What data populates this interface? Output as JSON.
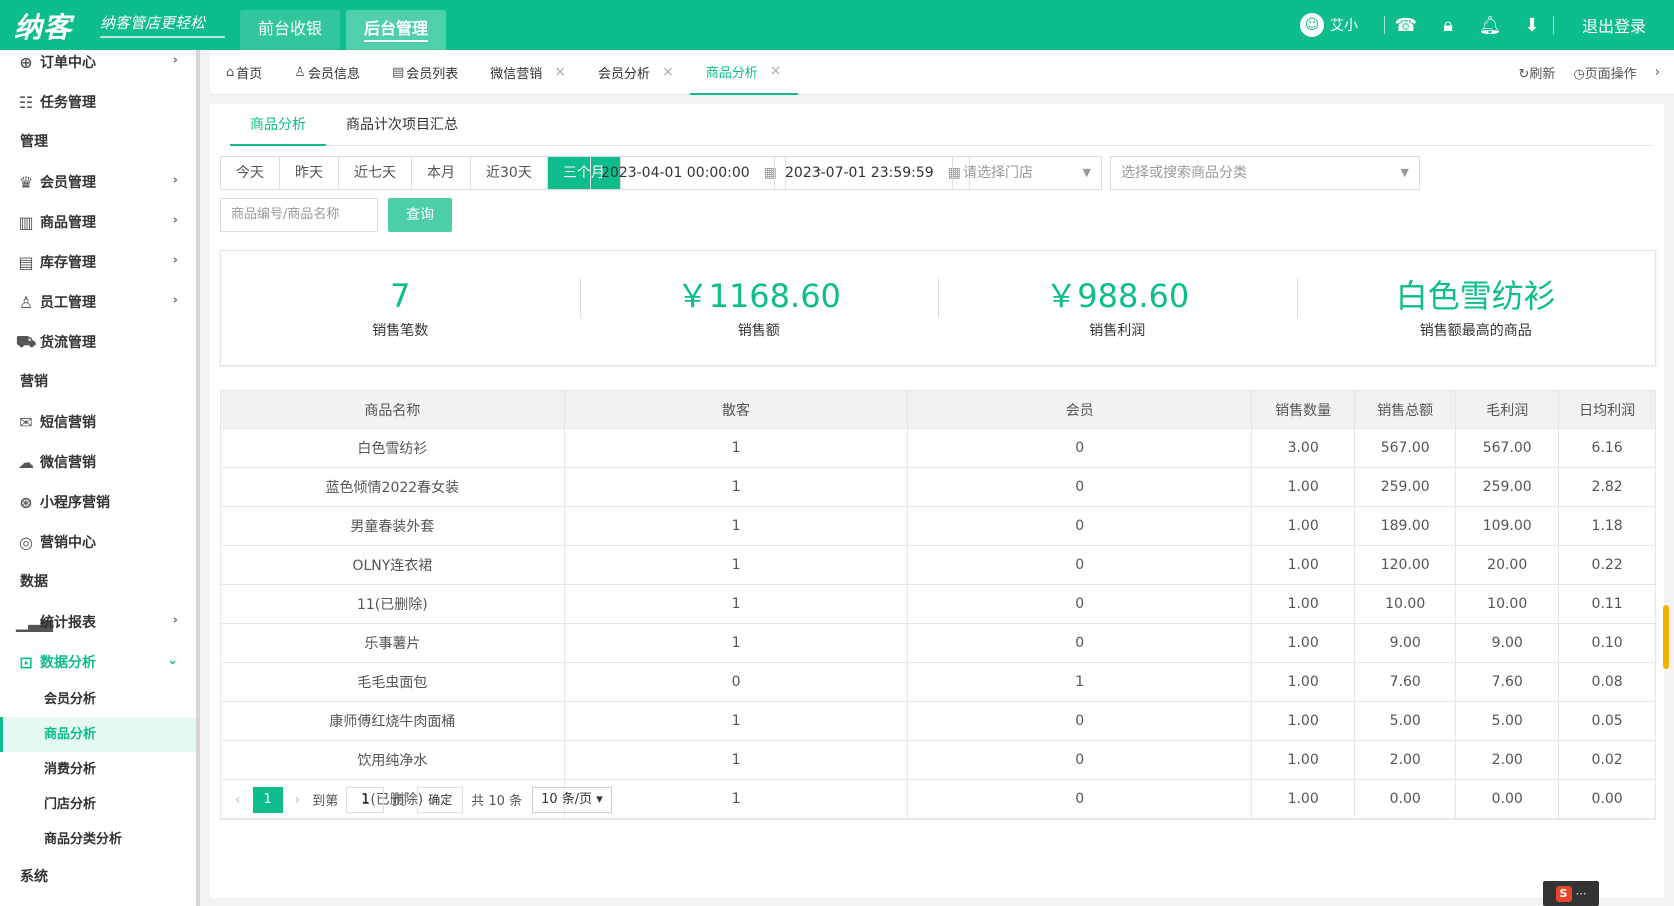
{
  "brand": {
    "logo": "纳客",
    "slogan": "纳客管店更轻松"
  },
  "topnav": [
    {
      "label": "前台收银"
    },
    {
      "label": "后台管理"
    }
  ],
  "user": {
    "name": "艾小",
    "logout": "退出登录"
  },
  "sidebar": {
    "items": [
      {
        "label": "订单中心"
      },
      {
        "label": "任务管理"
      },
      {
        "group": "管理"
      },
      {
        "label": "会员管理"
      },
      {
        "label": "商品管理"
      },
      {
        "label": "库存管理"
      },
      {
        "label": "员工管理"
      },
      {
        "label": "货流管理"
      },
      {
        "group": "营销"
      },
      {
        "label": "短信营销"
      },
      {
        "label": "微信营销"
      },
      {
        "label": "小程序营销"
      },
      {
        "label": "营销中心"
      },
      {
        "group": "数据"
      },
      {
        "label": "统计报表"
      },
      {
        "label": "数据分析"
      },
      {
        "sub": "会员分析"
      },
      {
        "sub": "商品分析"
      },
      {
        "sub": "消费分析"
      },
      {
        "sub": "门店分析"
      },
      {
        "sub": "商品分类分析"
      },
      {
        "group": "系统"
      }
    ]
  },
  "tabs": [
    {
      "label": "首页"
    },
    {
      "label": "会员信息"
    },
    {
      "label": "会员列表"
    },
    {
      "label": "微信营销"
    },
    {
      "label": "会员分析"
    },
    {
      "label": "商品分析"
    }
  ],
  "tab_actions": {
    "refresh": "刷新",
    "page_ops": "页面操作"
  },
  "subtabs": [
    {
      "label": "商品分析"
    },
    {
      "label": "商品计次项目汇总"
    }
  ],
  "filters": {
    "ranges": [
      "今天",
      "昨天",
      "近七天",
      "本月",
      "近30天",
      "三个月"
    ],
    "start": "2023-04-01 00:00:00",
    "end": "2023-07-01 23:59:59",
    "dash": "-",
    "store_placeholder": "请选择门店",
    "category_placeholder": "选择或搜索商品分类",
    "search_placeholder": "商品编号/商品名称",
    "query": "查询"
  },
  "stats": [
    {
      "value": "7",
      "label": "销售笔数"
    },
    {
      "value": "￥1168.60",
      "label": "销售额"
    },
    {
      "value": "￥988.60",
      "label": "销售利润"
    },
    {
      "value": "白色雪纺衫",
      "label": "销售额最高的商品"
    }
  ],
  "table": {
    "columns": [
      "商品名称",
      "散客",
      "会员",
      "销售数量",
      "销售总额",
      "毛利润",
      "日均利润"
    ],
    "rows": [
      [
        "白色雪纺衫",
        "1",
        "0",
        "3.00",
        "567.00",
        "567.00",
        "6.16"
      ],
      [
        "蓝色倾情2022春女装",
        "1",
        "0",
        "1.00",
        "259.00",
        "259.00",
        "2.82"
      ],
      [
        "男童春装外套",
        "1",
        "0",
        "1.00",
        "189.00",
        "109.00",
        "1.18"
      ],
      [
        "OLNY连衣裙",
        "1",
        "0",
        "1.00",
        "120.00",
        "20.00",
        "0.22"
      ],
      [
        "11(已删除)",
        "1",
        "0",
        "1.00",
        "10.00",
        "10.00",
        "0.11"
      ],
      [
        "乐事薯片",
        "1",
        "0",
        "1.00",
        "9.00",
        "9.00",
        "0.10"
      ],
      [
        "毛毛虫面包",
        "0",
        "1",
        "1.00",
        "7.60",
        "7.60",
        "0.08"
      ],
      [
        "康师傅红烧牛肉面桶",
        "1",
        "0",
        "1.00",
        "5.00",
        "5.00",
        "0.05"
      ],
      [
        "饮用纯净水",
        "1",
        "0",
        "1.00",
        "2.00",
        "2.00",
        "0.02"
      ],
      [
        "1(已删除)",
        "1",
        "0",
        "1.00",
        "0.00",
        "0.00",
        "0.00"
      ]
    ]
  },
  "pager": {
    "current": "1",
    "goto": "到第",
    "page_input": "1",
    "page": "页",
    "confirm": "确定",
    "total": "共 10 条",
    "size": "10 条/页"
  },
  "ime": {
    "label": "S"
  },
  "colors": {
    "primary": "#0dbd8b"
  }
}
